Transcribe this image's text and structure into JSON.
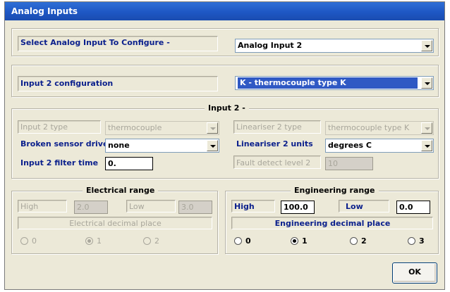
{
  "window": {
    "title": "Analog Inputs"
  },
  "select_input": {
    "label": "Select Analog Input To Configure -",
    "value": "Analog Input 2"
  },
  "configuration": {
    "label": "Input 2 configuration",
    "value": "K - thermocouple type K"
  },
  "input_group": {
    "legend": "Input 2 -",
    "type_label": "Input 2 type",
    "type_value": "thermocouple",
    "broken_sensor_label": "Broken sensor drive",
    "broken_sensor_value": "none",
    "filter_time_label": "Input 2 filter time",
    "filter_time_value": "0.",
    "lineariser_type_label": "Lineariser 2 type",
    "lineariser_type_value": "thermocouple type K",
    "lineariser_units_label": "Lineariser 2 units",
    "lineariser_units_value": "degrees C",
    "fault_detect_label": "Fault detect level 2",
    "fault_detect_value": "10"
  },
  "electrical": {
    "legend": "Electrical range",
    "high_label": "High",
    "high_value": "2.0",
    "low_label": "Low",
    "low_value": "3.0",
    "decimal_label": "Electrical decimal place",
    "radios": [
      "0",
      "1",
      "2"
    ],
    "selected": "1"
  },
  "engineering": {
    "legend": "Engineering range",
    "high_label": "High",
    "high_value": "100.0",
    "low_label": "Low",
    "low_value": "0.0",
    "decimal_label": "Engineering decimal place",
    "radios": [
      "0",
      "1",
      "2",
      "3"
    ],
    "selected": "1"
  },
  "ok_button": {
    "label": "OK"
  }
}
